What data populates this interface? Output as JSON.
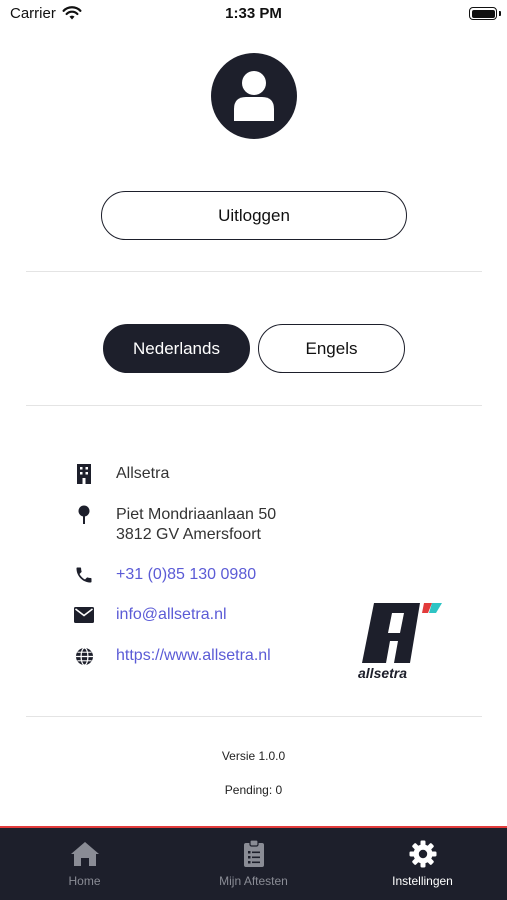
{
  "status_bar": {
    "carrier": "Carrier",
    "time": "1:33 PM"
  },
  "account": {
    "logout_label": "Uitloggen"
  },
  "language": {
    "options": [
      "Nederlands",
      "Engels"
    ],
    "selected": "Nederlands"
  },
  "contact": {
    "company": "Allsetra",
    "address_line1": "Piet Mondriaanlaan 50",
    "address_line2": "3812 GV Amersfoort",
    "phone": "+31 (0)85 130 0980",
    "email": "info@allsetra.nl",
    "website": "https://www.allsetra.nl"
  },
  "logo": {
    "text": "allsetra"
  },
  "meta": {
    "version": "Versie 1.0.0",
    "pending": "Pending: 0"
  },
  "tabbar": {
    "tabs": [
      {
        "label": "Home",
        "icon": "home-icon"
      },
      {
        "label": "Mijn Aftesten",
        "icon": "clipboard-icon"
      },
      {
        "label": "Instellingen",
        "icon": "gear-icon"
      }
    ],
    "active": "Instellingen"
  },
  "colors": {
    "dark": "#1d1f2b",
    "link": "#5b5bd6",
    "accent_line": "#e23b3b"
  }
}
